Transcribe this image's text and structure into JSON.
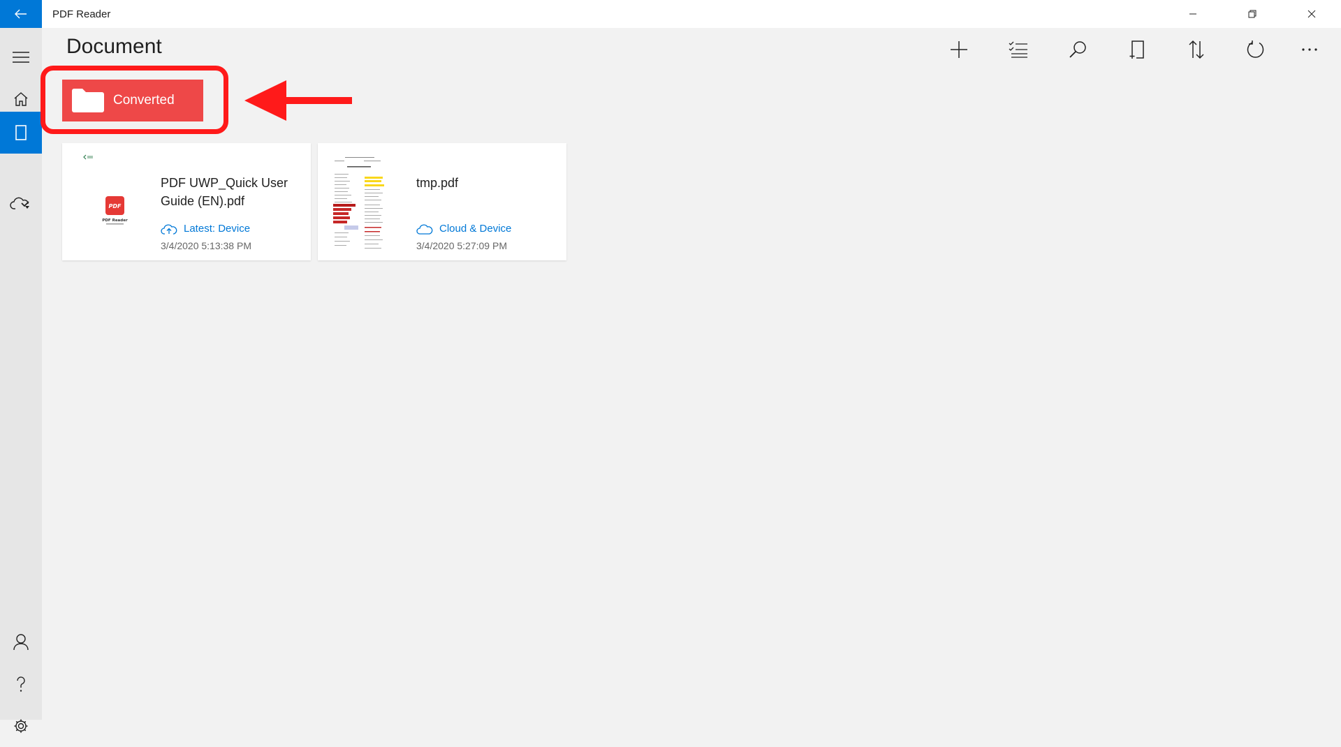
{
  "titlebar": {
    "app_title": "PDF Reader"
  },
  "header": {
    "title": "Document"
  },
  "folder": {
    "label": "Converted",
    "color": "#ee4848"
  },
  "documents": [
    {
      "name": "PDF UWP_Quick User Guide (EN).pdf",
      "status": "Latest: Device",
      "date": "3/4/2020 5:13:38 PM",
      "thumb_title": "PDF Reader",
      "thumb_badge": "PDF"
    },
    {
      "name": "tmp.pdf",
      "status": "Cloud & Device",
      "date": "3/4/2020 5:27:09 PM"
    }
  ],
  "colors": {
    "accent": "#0078d7",
    "highlight": "#ff1a1a"
  }
}
